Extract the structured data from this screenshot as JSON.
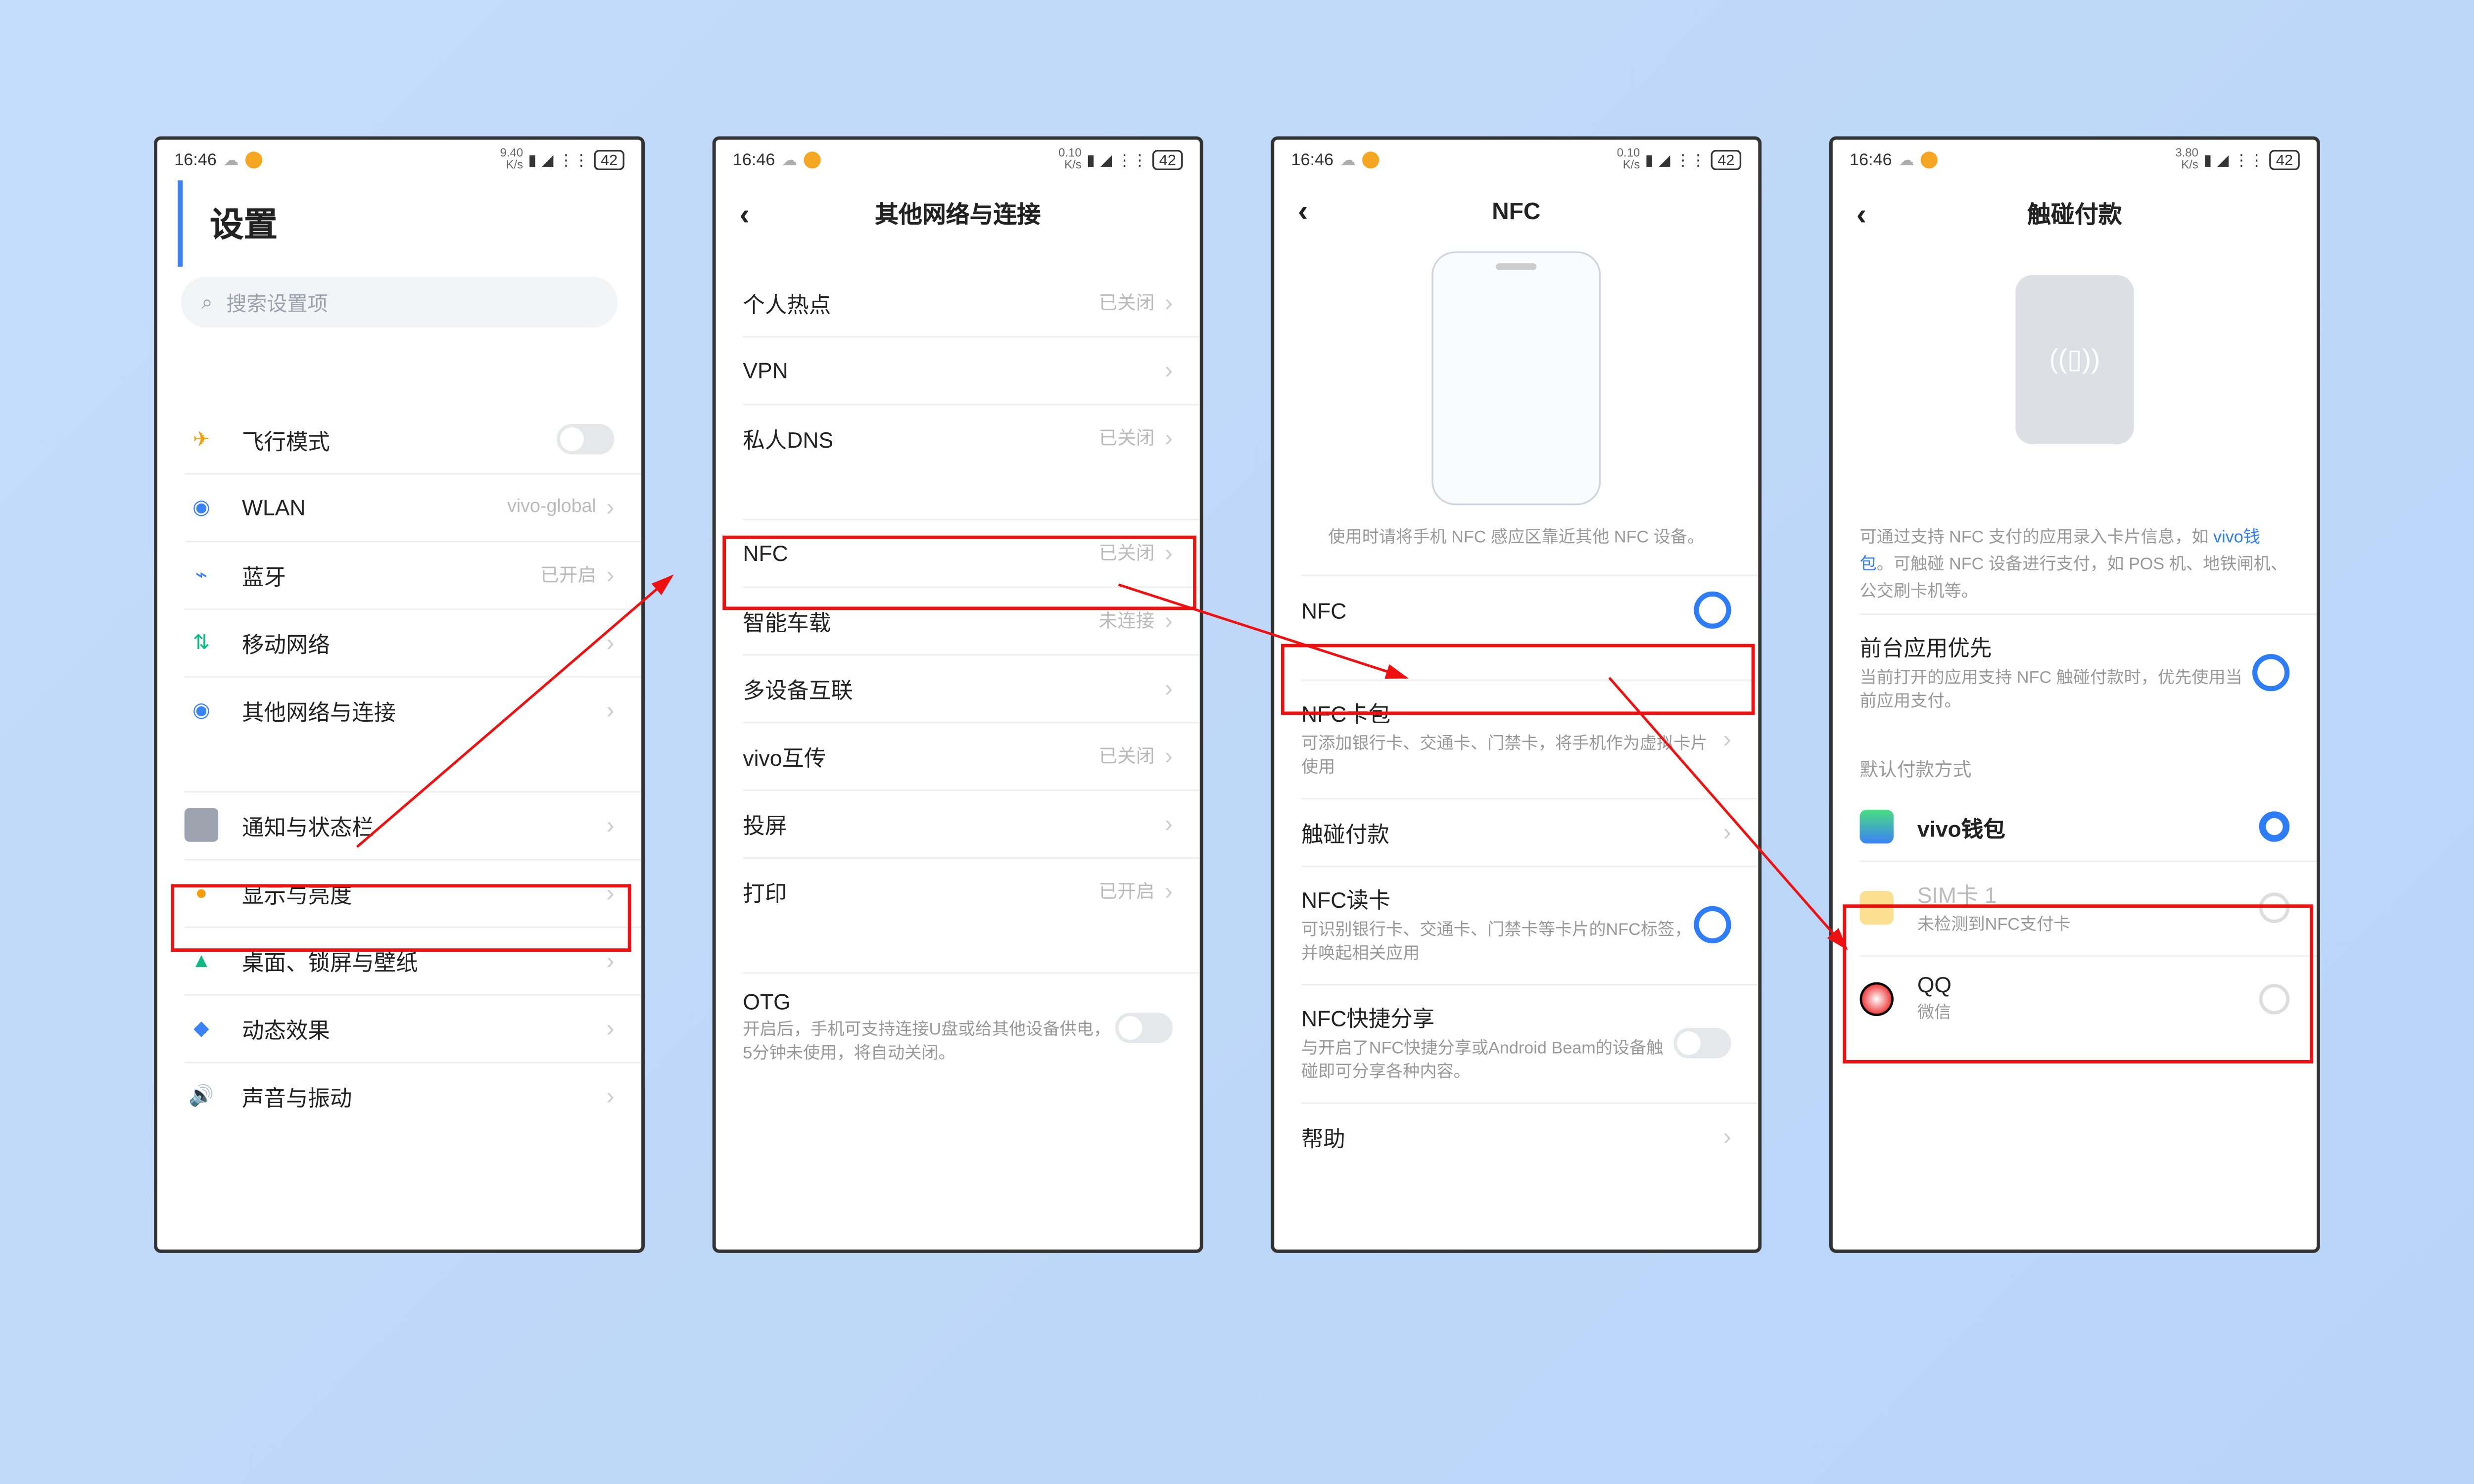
{
  "status": {
    "time": "16:46",
    "speed1": "9.40",
    "speed2": "0.10",
    "speed3": "0.10",
    "speed4": "3.80",
    "unit": "K/s",
    "battery": "42"
  },
  "screen1": {
    "title": "设置",
    "search_placeholder": "搜索设置项",
    "rows": {
      "airplane": "飞行模式",
      "wlan": "WLAN",
      "wlan_val": "vivo-global",
      "bt": "蓝牙",
      "bt_val": "已开启",
      "mobile": "移动网络",
      "other": "其他网络与连接",
      "notif": "通知与状态栏",
      "display": "显示与亮度",
      "desktop": "桌面、锁屏与壁纸",
      "motion": "动态效果",
      "sound": "声音与振动"
    }
  },
  "screen2": {
    "title": "其他网络与连接",
    "rows": {
      "hotspot": "个人热点",
      "hotspot_val": "已关闭",
      "vpn": "VPN",
      "dns": "私人DNS",
      "dns_val": "已关闭",
      "nfc": "NFC",
      "nfc_val": "已关闭",
      "car": "智能车载",
      "car_val": "未连接",
      "multi": "多设备互联",
      "vivoshare": "vivo互传",
      "vivoshare_val": "已关闭",
      "cast": "投屏",
      "print": "打印",
      "print_val": "已开启",
      "otg": "OTG",
      "otg_sub": "开启后，手机可支持连接U盘或给其他设备供电，5分钟未使用，将自动关闭。"
    }
  },
  "screen3": {
    "title": "NFC",
    "hint": "使用时请将手机 NFC 感应区靠近其他 NFC 设备。",
    "rows": {
      "nfc": "NFC",
      "cardbag": "NFC卡包",
      "cardbag_sub": "可添加银行卡、交通卡、门禁卡，将手机作为虚拟卡片使用",
      "tap": "触碰付款",
      "read": "NFC读卡",
      "read_sub": "可识别银行卡、交通卡、门禁卡等卡片的NFC标签，并唤起相关应用",
      "share": "NFC快捷分享",
      "share_sub": "与开启了NFC快捷分享或Android Beam的设备触碰即可分享各种内容。",
      "help": "帮助"
    }
  },
  "screen4": {
    "title": "触碰付款",
    "para1a": "可通过支持 NFC 支付的应用录入卡片信息，如 ",
    "para1link": "vivo钱包",
    "para1b": "。可触碰 NFC 设备进行支付，如 POS 机、地铁闸机、公交刷卡机等。",
    "rows": {
      "fg": "前台应用优先",
      "fg_sub": "当前打开的应用支持 NFC 触碰付款时，优先使用当前应用支付。"
    },
    "sect_default": "默认付款方式",
    "opts": {
      "vivo": "vivo钱包",
      "sim": "SIM卡 1",
      "sim_sub": "未检测到NFC支付卡",
      "qq": "QQ",
      "qq_sub": "微信"
    }
  }
}
